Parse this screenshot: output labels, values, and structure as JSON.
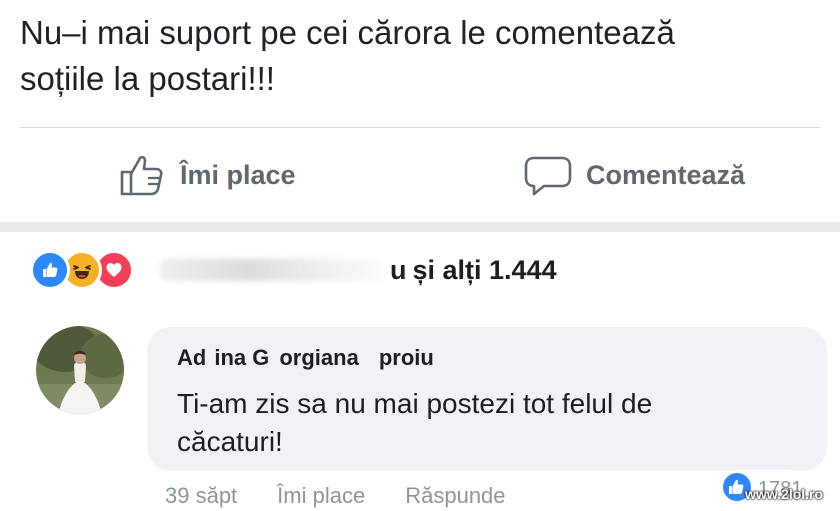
{
  "post": {
    "text_lines": [
      "Nu–i mai suport pe cei cărora le comentează",
      "soțiile la postari!!!"
    ]
  },
  "actions": {
    "like_label": "Îmi place",
    "comment_label": "Comentează",
    "like_icon": "thumbs-up-icon",
    "comment_icon": "speech-bubble-icon"
  },
  "reactions": {
    "icons": [
      "like-reaction-icon",
      "haha-reaction-icon",
      "love-reaction-icon"
    ],
    "names_suffix": "u",
    "others_text": "și alți 1.444"
  },
  "comment": {
    "author_parts": [
      "Ad",
      "ina G",
      "orgiana ",
      "proiu"
    ],
    "text_lines": [
      "Ti-am zis sa nu mai postezi tot felul de",
      "căcaturi!"
    ],
    "time": "39 săpt",
    "like_label": "Îmi place",
    "reply_label": "Răspunde",
    "reaction_count": "1781"
  },
  "watermark": "www.2lol.ro",
  "colors": {
    "like_blue": "#2d88ff",
    "haha_yellow": "#f7b125",
    "love_red": "#f33e58",
    "bubble_bg": "#f0f2f5",
    "muted_text": "#8d949e",
    "action_text": "#606770"
  }
}
